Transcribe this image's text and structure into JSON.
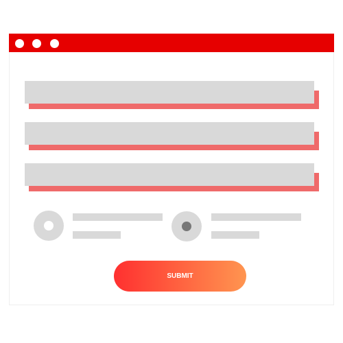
{
  "button": {
    "label": "SUBMIT"
  },
  "colors": {
    "titlebar": "#e60000",
    "shadow": "#ef6a6a",
    "field": "#d9d9d9",
    "gradient_start": "#ff3030",
    "gradient_end": "#ff9550"
  },
  "radios": [
    {
      "selected": false
    },
    {
      "selected": true
    }
  ]
}
